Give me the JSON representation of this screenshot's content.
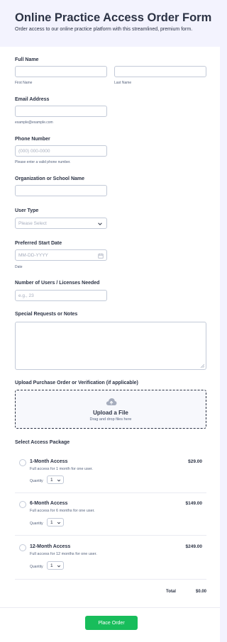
{
  "form": {
    "title": "Online Practice Access Order Form",
    "subtitle": "Order access to our online practice platform with this streamlined, premium form."
  },
  "full_name": {
    "label": "Full Name",
    "first_sublabel": "First Name",
    "last_sublabel": "Last Name"
  },
  "email": {
    "label": "Email Address",
    "sublabel": "example@example.com"
  },
  "phone": {
    "label": "Phone Number",
    "placeholder": "(000) 000-0000",
    "sublabel": "Please enter a valid phone number."
  },
  "organization": {
    "label": "Organization or School Name"
  },
  "user_type": {
    "label": "User Type",
    "selected": "Please Select"
  },
  "start_date": {
    "label": "Preferred Start Date",
    "placeholder": "MM-DD-YYYY",
    "sublabel": "Date"
  },
  "users": {
    "label": "Number of Users / Licenses Needed",
    "placeholder": "e.g., 23"
  },
  "notes": {
    "label": "Special Requests or Notes"
  },
  "upload": {
    "label": "Upload Purchase Order or Verification (if applicable)",
    "title": "Upload a File",
    "subtitle": "Drag and drop files here",
    "icon": "cloud-upload-icon"
  },
  "packages": {
    "label": "Select Access Package",
    "quantity_label": "Quantity",
    "items": [
      {
        "name": "1-Month Access",
        "description": "Full access for 1 month for one user.",
        "price": "$29.00",
        "quantity": "1"
      },
      {
        "name": "6-Month Access",
        "description": "Full access for 6 months for one user.",
        "price": "$149.00",
        "quantity": "1"
      },
      {
        "name": "12-Month Access",
        "description": "Full access for 12 months for one user.",
        "price": "$249.00",
        "quantity": "1"
      }
    ],
    "total_label": "Total",
    "total_value": "$0.00"
  },
  "submit": {
    "label": "Place Order",
    "color": "#18bd5b"
  }
}
